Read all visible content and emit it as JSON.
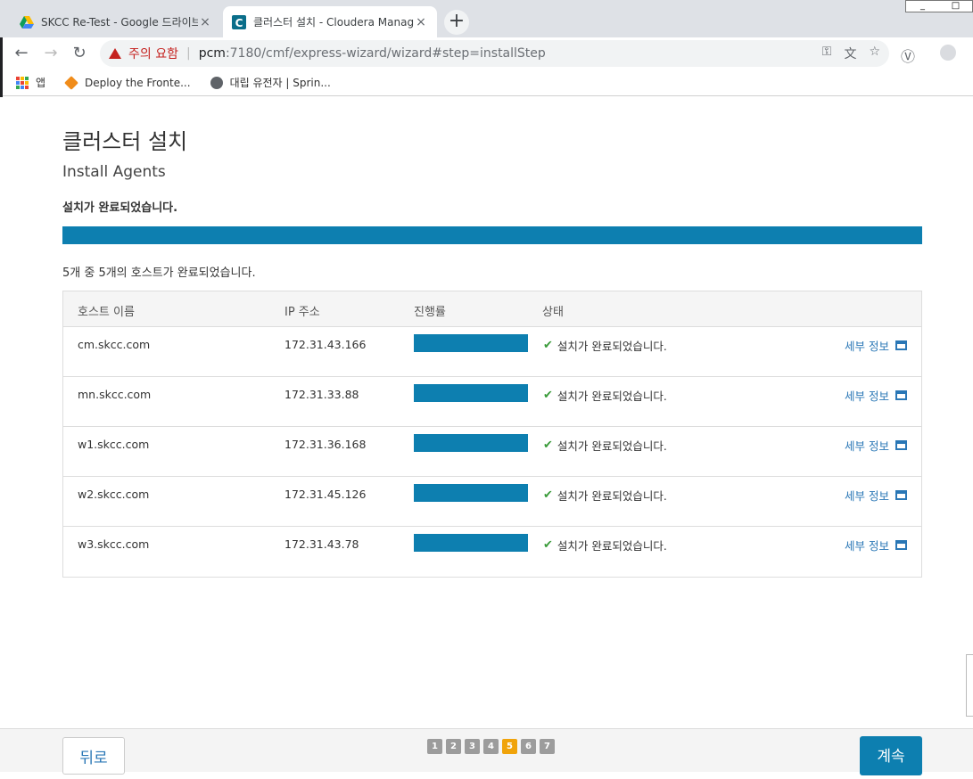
{
  "browser": {
    "tabs": [
      {
        "title": "SKCC Re-Test - Google 드라이브",
        "active": false,
        "icon": "google-drive-icon"
      },
      {
        "title": "클러스터 설치 - Cloudera Manager",
        "active": true,
        "icon": "cloudera-icon"
      }
    ],
    "new_tab": "+",
    "close_glyph": "×",
    "security_label": "주의 요함",
    "url_host": "pcm",
    "url_rest": ":7180/cmf/express-wizard/wizard#step=installStep",
    "bookmarks": [
      {
        "label": "앱",
        "icon": "apps-icon"
      },
      {
        "label": "Deploy the Fronte...",
        "icon": "cube-icon"
      },
      {
        "label": "대립 유전자 | Sprin...",
        "icon": "globe-icon"
      }
    ]
  },
  "page": {
    "title": "클러스터 설치",
    "subtitle": "Install Agents",
    "status": "설치가 완료되었습니다.",
    "overall_progress": 1.0,
    "summary": "5개 중 5개의 호스트가 완료되었습니다."
  },
  "table": {
    "headers": {
      "host": "호스트 이름",
      "ip": "IP 주소",
      "progress": "진행률",
      "status": "상태"
    },
    "rows": [
      {
        "host": "cm.skcc.com",
        "ip": "172.31.43.166",
        "progress": 1.0,
        "status": "설치가 완료되었습니다.",
        "detail": "세부 정보"
      },
      {
        "host": "mn.skcc.com",
        "ip": "172.31.33.88",
        "progress": 1.0,
        "status": "설치가 완료되었습니다.",
        "detail": "세부 정보"
      },
      {
        "host": "w1.skcc.com",
        "ip": "172.31.36.168",
        "progress": 1.0,
        "status": "설치가 완료되었습니다.",
        "detail": "세부 정보"
      },
      {
        "host": "w2.skcc.com",
        "ip": "172.31.45.126",
        "progress": 1.0,
        "status": "설치가 완료되었습니다.",
        "detail": "세부 정보"
      },
      {
        "host": "w3.skcc.com",
        "ip": "172.31.43.78",
        "progress": 1.0,
        "status": "설치가 완료되었습니다.",
        "detail": "세부 정보"
      }
    ]
  },
  "footer": {
    "back_label": "뒤로",
    "continue_label": "계속",
    "steps": [
      "1",
      "2",
      "3",
      "4",
      "5",
      "6",
      "7"
    ],
    "current_step": "5"
  },
  "colors": {
    "accent": "#0d7fb0",
    "step_current": "#f0a30a",
    "link": "#2a77b6",
    "success": "#3a9b3a"
  }
}
